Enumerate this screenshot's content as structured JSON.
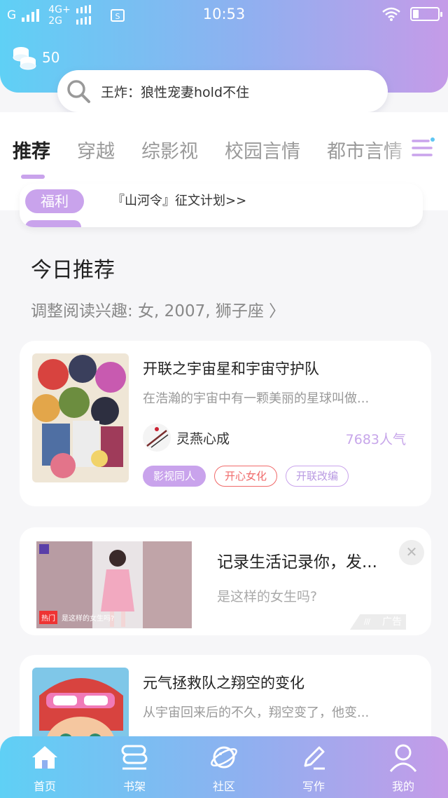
{
  "status_bar": {
    "net1": "G",
    "net2_top": "4G+",
    "net2_bottom": "2G",
    "time": "10:53"
  },
  "header": {
    "coins": "50",
    "search_text": "王炸：狼性宠妻hold不住"
  },
  "tabs": [
    "推荐",
    "穿越",
    "综影视",
    "校园言情",
    "都市言情"
  ],
  "active_tab": "推荐",
  "notice": {
    "tag": "福利",
    "text": "『山河令』征文计划>>"
  },
  "section": {
    "title": "今日推荐",
    "interest": "调整阅读兴趣: 女, 2007, 狮子座 〉"
  },
  "books": [
    {
      "title": "开联之宇宙星和宇宙守护队",
      "desc": "在浩瀚的宇宙中有一颗美丽的星球叫做...",
      "author": "灵燕心成",
      "popularity": "7683人气",
      "tags": [
        "影视同人",
        "开心女化",
        "开联改编"
      ]
    },
    {
      "title": "元气拯救队之翔空的变化",
      "desc": "从宇宙回来后的不久，翔空变了，他变..."
    }
  ],
  "ad": {
    "title": "记录生活记录你，发...",
    "subtitle": "是这样的女生吗?",
    "badge": "广告",
    "thumb_tag": "热门",
    "thumb_text": "是这样的女生吗?"
  },
  "bottom_nav": [
    {
      "label": "首页",
      "icon": "home-icon"
    },
    {
      "label": "书架",
      "icon": "bookshelf-icon"
    },
    {
      "label": "社区",
      "icon": "planet-icon"
    },
    {
      "label": "写作",
      "icon": "pen-icon"
    },
    {
      "label": "我的",
      "icon": "user-icon"
    }
  ],
  "colors": {
    "accent_purple": "#c9a3ec",
    "gradient_start": "#5fd0f5",
    "gradient_end": "#c59be8",
    "tag_red": "#f06a6a"
  }
}
